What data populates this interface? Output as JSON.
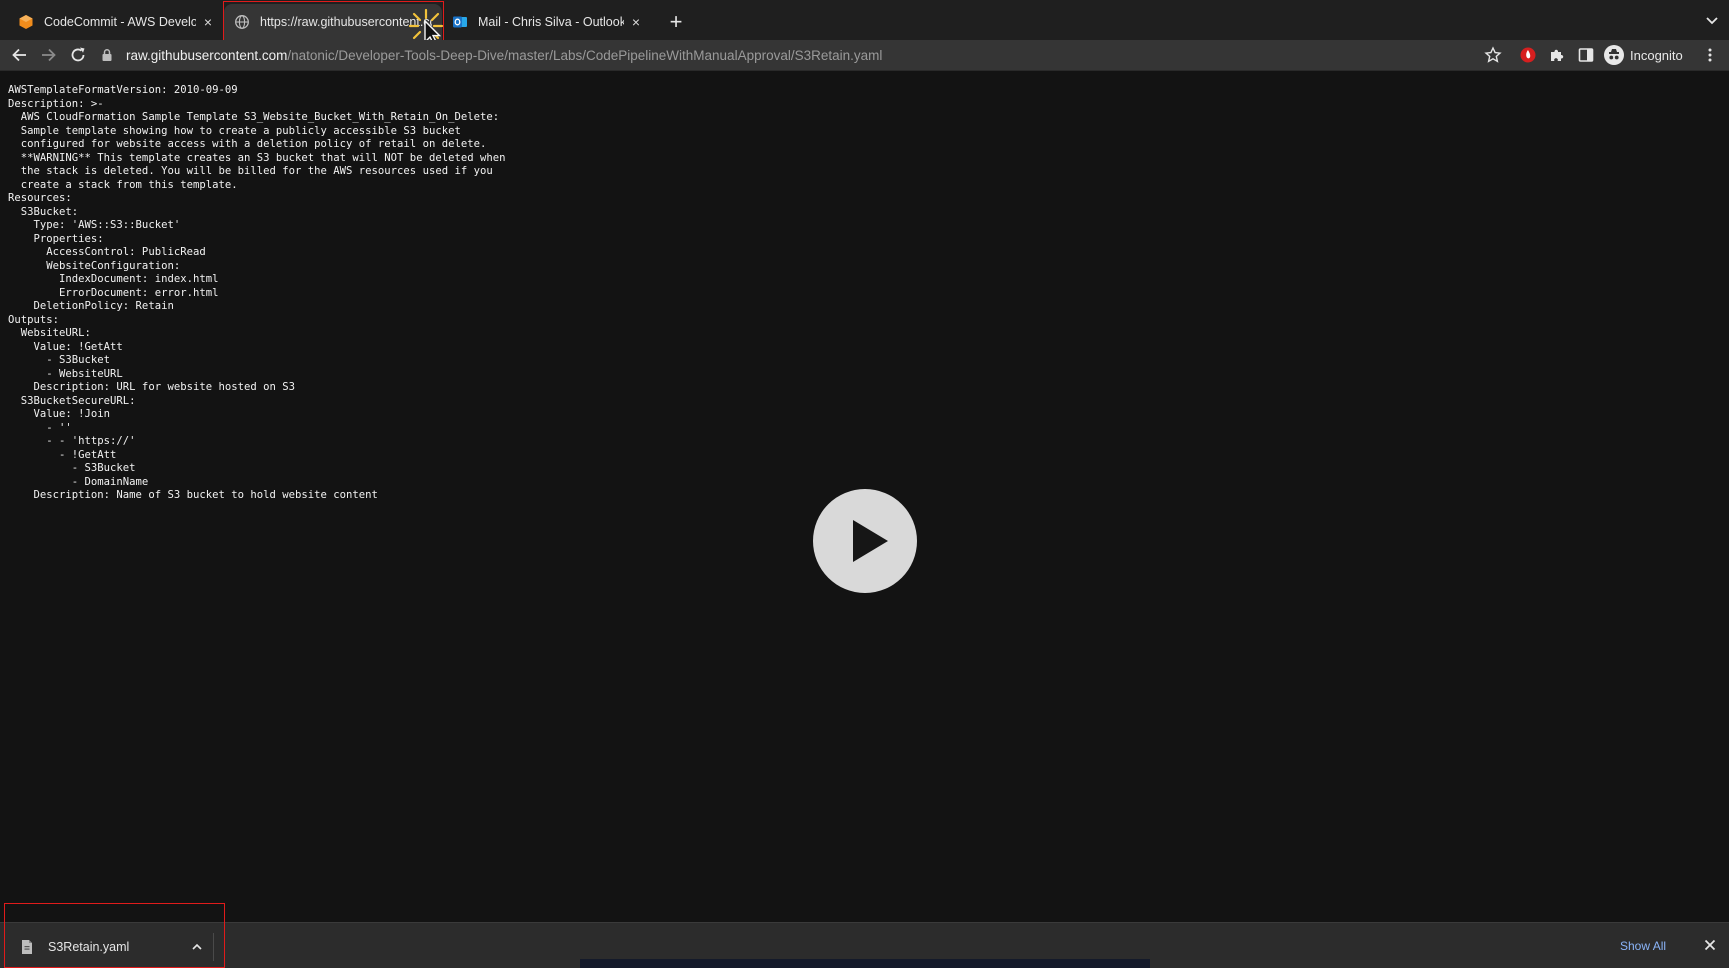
{
  "tabs": [
    {
      "title": "CodeCommit - AWS Developer",
      "close": "×",
      "active": false
    },
    {
      "title": "https://raw.githubusercontent.com",
      "close": "×",
      "active": true
    },
    {
      "title": "Mail - Chris Silva - Outlook",
      "close": "×",
      "active": false
    }
  ],
  "new_tab_label": "+",
  "address": {
    "host": "raw.githubusercontent.com",
    "path": "/natonic/Developer-Tools-Deep-Dive/master/Labs/CodePipelineWithManualApproval/S3Retain.yaml"
  },
  "profile": {
    "label": "Incognito"
  },
  "file_content": "AWSTemplateFormatVersion: 2010-09-09\nDescription: >-\n  AWS CloudFormation Sample Template S3_Website_Bucket_With_Retain_On_Delete:\n  Sample template showing how to create a publicly accessible S3 bucket\n  configured for website access with a deletion policy of retail on delete.\n  **WARNING** This template creates an S3 bucket that will NOT be deleted when\n  the stack is deleted. You will be billed for the AWS resources used if you\n  create a stack from this template.\nResources:\n  S3Bucket:\n    Type: 'AWS::S3::Bucket'\n    Properties:\n      AccessControl: PublicRead\n      WebsiteConfiguration:\n        IndexDocument: index.html\n        ErrorDocument: error.html\n    DeletionPolicy: Retain\nOutputs:\n  WebsiteURL:\n    Value: !GetAtt\n      - S3Bucket\n      - WebsiteURL\n    Description: URL for website hosted on S3\n  S3BucketSecureURL:\n    Value: !Join\n      - ''\n      - - 'https://'\n        - !GetAtt\n          - S3Bucket\n          - DomainName\n    Description: Name of S3 bucket to hold website content",
  "download": {
    "filename": "S3Retain.yaml"
  },
  "shelf": {
    "show_all_label": "Show All"
  },
  "icons": {
    "tab1": "aws-icon",
    "tab2": "globe-icon",
    "tab3": "outlook-icon",
    "back": "back-arrow-icon",
    "forward": "forward-arrow-icon",
    "reload": "reload-icon",
    "lock": "lock-icon",
    "bookmark": "star-icon",
    "extension_red": "red-extension-icon",
    "extensions": "puzzle-icon",
    "sidepanel": "side-panel-icon",
    "menu": "kebab-menu-icon",
    "play": "play-icon",
    "cursor": "mouse-pointer-icon"
  },
  "colors": {
    "highlight": "#e01b1b",
    "aws_orange": "#f08c1c",
    "outlook_blue": "#1a73c8",
    "link_blue": "#8ab4f8"
  }
}
